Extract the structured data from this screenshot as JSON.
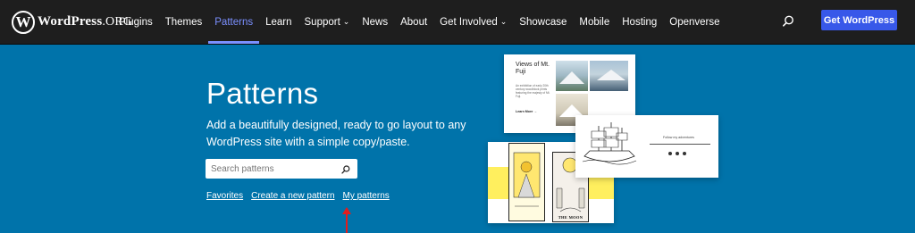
{
  "header": {
    "logo_main": "WordPress",
    "logo_suffix": ".ORG",
    "nav": [
      {
        "label": "Plugins",
        "dropdown": false,
        "active": false
      },
      {
        "label": "Themes",
        "dropdown": false,
        "active": false
      },
      {
        "label": "Patterns",
        "dropdown": false,
        "active": true
      },
      {
        "label": "Learn",
        "dropdown": false,
        "active": false
      },
      {
        "label": "Support",
        "dropdown": true,
        "active": false
      },
      {
        "label": "News",
        "dropdown": false,
        "active": false
      },
      {
        "label": "About",
        "dropdown": false,
        "active": false
      },
      {
        "label": "Get Involved",
        "dropdown": true,
        "active": false
      },
      {
        "label": "Showcase",
        "dropdown": false,
        "active": false
      },
      {
        "label": "Mobile",
        "dropdown": false,
        "active": false
      },
      {
        "label": "Hosting",
        "dropdown": false,
        "active": false
      },
      {
        "label": "Openverse",
        "dropdown": false,
        "active": false
      }
    ],
    "get_wordpress": "Get WordPress"
  },
  "hero": {
    "title": "Patterns",
    "description": "Add a beautifully designed, ready to go layout to any WordPress site with a simple copy/paste.",
    "search_placeholder": "Search patterns",
    "links": {
      "favorites": "Favorites",
      "create": "Create a new pattern",
      "mine": "My patterns"
    }
  },
  "previews": {
    "fuji_title": "Views of Mt. Fuji",
    "fuji_body": "An exhibition of early 20th century woodblock prints featuring the majesty of Mt. Fuji.",
    "fuji_link": "Learn More →",
    "ship_follow": "Follow my adventures",
    "tarot_label": "THE MOON"
  },
  "colors": {
    "hero_bg": "#0073aa",
    "header_bg": "#1e1e1e",
    "accent": "#3858e9",
    "active_nav": "#7b90ff",
    "annotation_arrow": "#e11d1d"
  }
}
